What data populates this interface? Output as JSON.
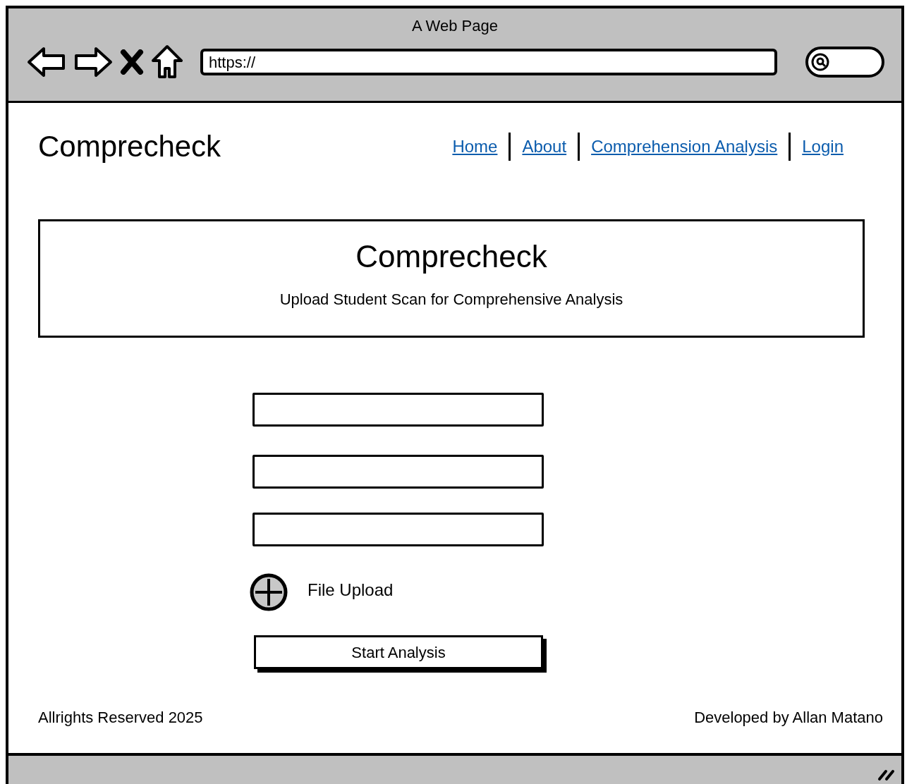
{
  "window": {
    "title": "A Web Page",
    "address": "https://"
  },
  "header": {
    "logo": "Comprecheck",
    "nav": [
      {
        "label": "Home"
      },
      {
        "label": "About"
      },
      {
        "label": "Comprehension Analysis"
      },
      {
        "label": "Login"
      }
    ]
  },
  "hero": {
    "title": "Comprecheck",
    "subtitle": "Upload Student Scan for Comprehensive Analysis"
  },
  "form": {
    "fields": [
      {
        "kind": "text"
      },
      {
        "kind": "text"
      },
      {
        "kind": "text"
      }
    ],
    "upload_label": "File Upload",
    "submit": "Start Analysis"
  },
  "footer": {
    "left": "Allrights Reserved 2025",
    "right": "Developed by Allan Matano"
  }
}
